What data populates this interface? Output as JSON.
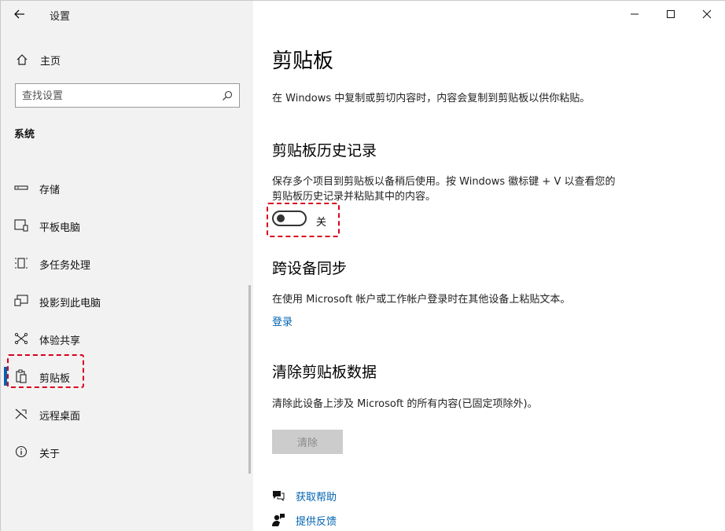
{
  "window": {
    "title": "设置",
    "controls": [
      "minimize",
      "maximize",
      "close"
    ]
  },
  "sidebar": {
    "home_label": "主页",
    "search_placeholder": "查找设置",
    "section": "系统",
    "items": [
      {
        "label": "存储",
        "icon": "storage-icon"
      },
      {
        "label": "平板电脑",
        "icon": "tablet-icon"
      },
      {
        "label": "多任务处理",
        "icon": "multitasking-icon"
      },
      {
        "label": "投影到此电脑",
        "icon": "projecting-icon"
      },
      {
        "label": "体验共享",
        "icon": "shared-experiences-icon"
      },
      {
        "label": "剪贴板",
        "icon": "clipboard-icon",
        "selected": true
      },
      {
        "label": "远程桌面",
        "icon": "remote-desktop-icon"
      },
      {
        "label": "关于",
        "icon": "info-icon"
      }
    ]
  },
  "main": {
    "title": "剪贴板",
    "description": "在 Windows 中复制或剪切内容时，内容会复制到剪贴板以供你粘贴。",
    "history": {
      "heading": "剪贴板历史记录",
      "text": "保存多个项目到剪贴板以备稍后使用。按 Windows 徽标键 + V 以查看您的剪贴板历史记录并粘贴其中的内容。",
      "toggle_state": "关",
      "toggle_on": false
    },
    "sync": {
      "heading": "跨设备同步",
      "text": "在使用 Microsoft 帐户或工作帐户登录时在其他设备上粘贴文本。",
      "link": "登录"
    },
    "clear": {
      "heading": "清除剪贴板数据",
      "text": "清除此设备上涉及 Microsoft 的所有内容(已固定项除外)。",
      "button": "清除"
    },
    "help": {
      "get_help": "获取帮助",
      "feedback": "提供反馈"
    }
  },
  "colors": {
    "accent": "#0063b1",
    "highlight_dash": "#d9001b",
    "sidebar_bg": "#f2f2f2"
  }
}
